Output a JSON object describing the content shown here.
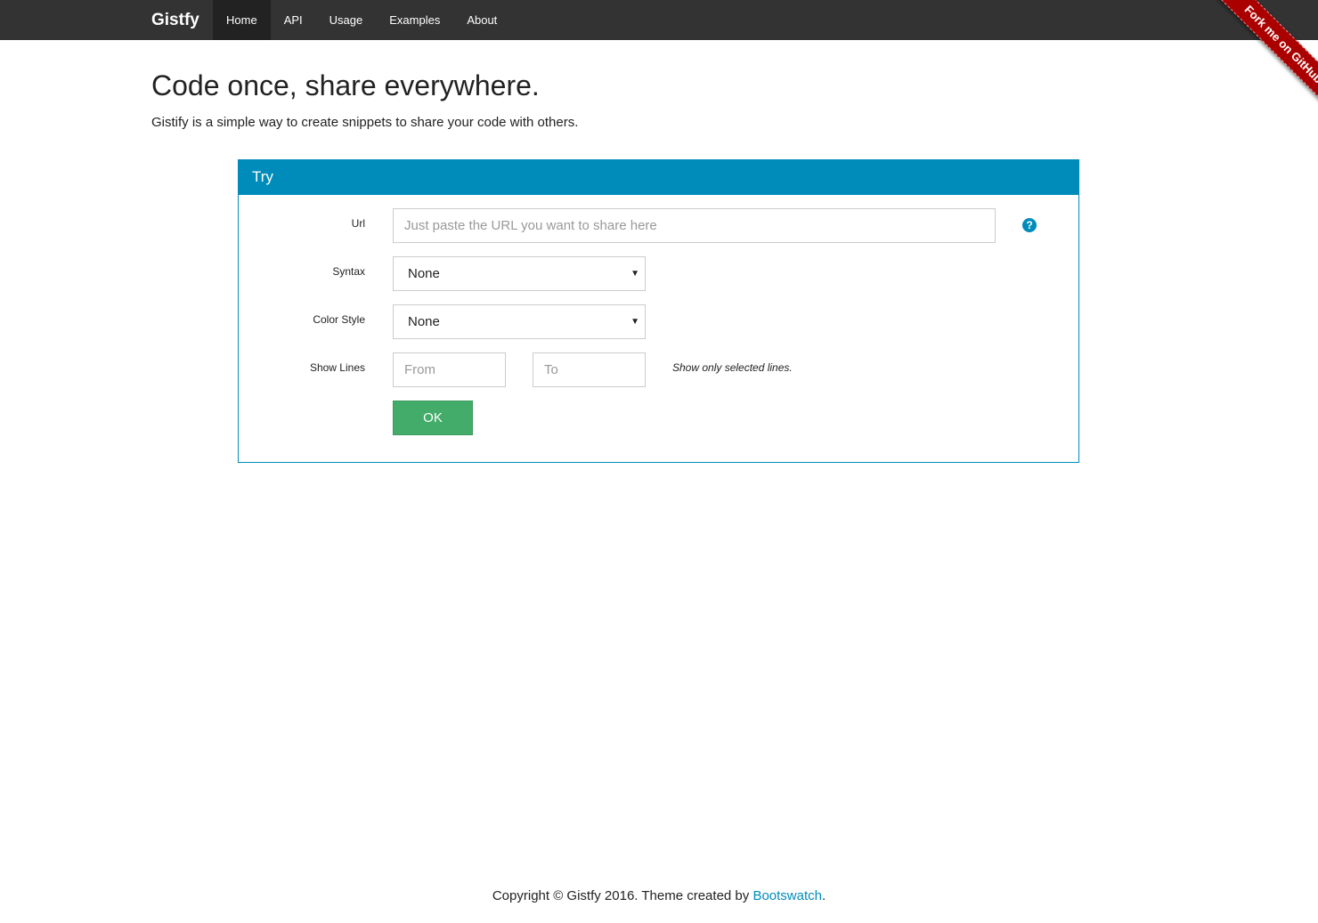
{
  "navbar": {
    "brand": "Gistfy",
    "items": [
      {
        "label": "Home",
        "active": true
      },
      {
        "label": "API"
      },
      {
        "label": "Usage"
      },
      {
        "label": "Examples"
      },
      {
        "label": "About"
      }
    ]
  },
  "ribbon": {
    "label": "Fork me on GitHub"
  },
  "header": {
    "title": "Code once, share everywhere.",
    "lead": "Gistify is a simple way to create snippets to share your code with others."
  },
  "panel": {
    "title": "Try",
    "url": {
      "label": "Url",
      "placeholder": "Just paste the URL you want to share here",
      "value": ""
    },
    "syntax": {
      "label": "Syntax",
      "selected": "None"
    },
    "color_style": {
      "label": "Color Style",
      "selected": "None"
    },
    "show_lines": {
      "label": "Show Lines",
      "from_placeholder": "From",
      "to_placeholder": "To",
      "hint": "Show only selected lines."
    },
    "submit_label": "OK"
  },
  "footer": {
    "text": "Copyright © Gistfy 2016. Theme created by ",
    "link": "Bootswatch",
    "suffix": "."
  },
  "colors": {
    "navbar_bg": "#333333",
    "primary": "#008cba",
    "success": "#43ac6a",
    "ribbon": "#aa0000"
  },
  "icons": {
    "help": "question-circle-icon",
    "select_caret": "caret-down-icon"
  }
}
